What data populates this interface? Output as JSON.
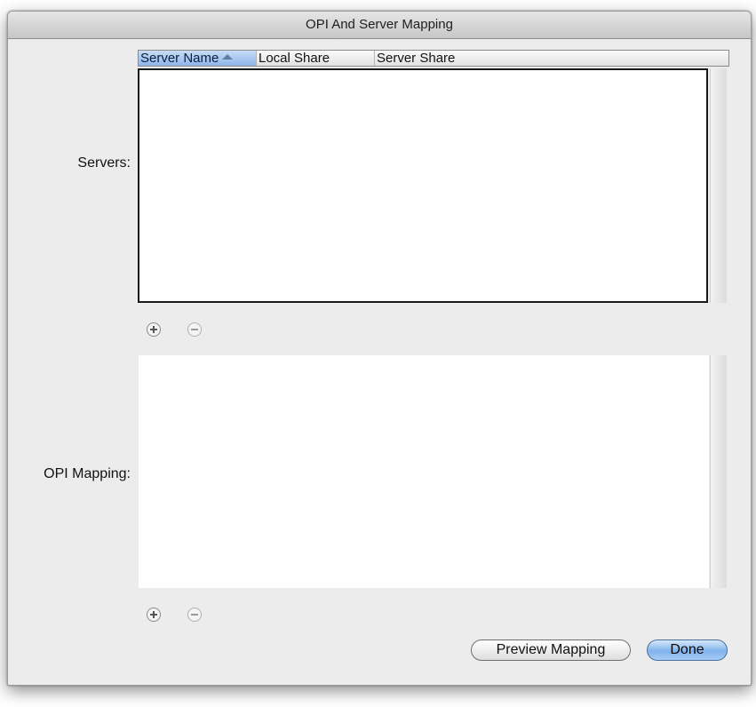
{
  "window": {
    "title": "OPI And Server Mapping"
  },
  "servers": {
    "label": "Servers:",
    "columns": [
      {
        "label": "Server Name",
        "sorted": true
      },
      {
        "label": "Local Share",
        "sorted": false
      },
      {
        "label": "Server Share",
        "sorted": false
      }
    ],
    "rows": [],
    "add_icon": "plus-icon",
    "remove_icon": "minus-icon"
  },
  "opi_mapping": {
    "label": "OPI Mapping:",
    "rows": [],
    "add_icon": "plus-icon",
    "remove_icon": "minus-icon"
  },
  "buttons": {
    "preview_label": "Preview Mapping",
    "done_label": "Done"
  },
  "colors": {
    "default_button": "#7fb2ec",
    "sorted_column": "#8fb5ea"
  }
}
